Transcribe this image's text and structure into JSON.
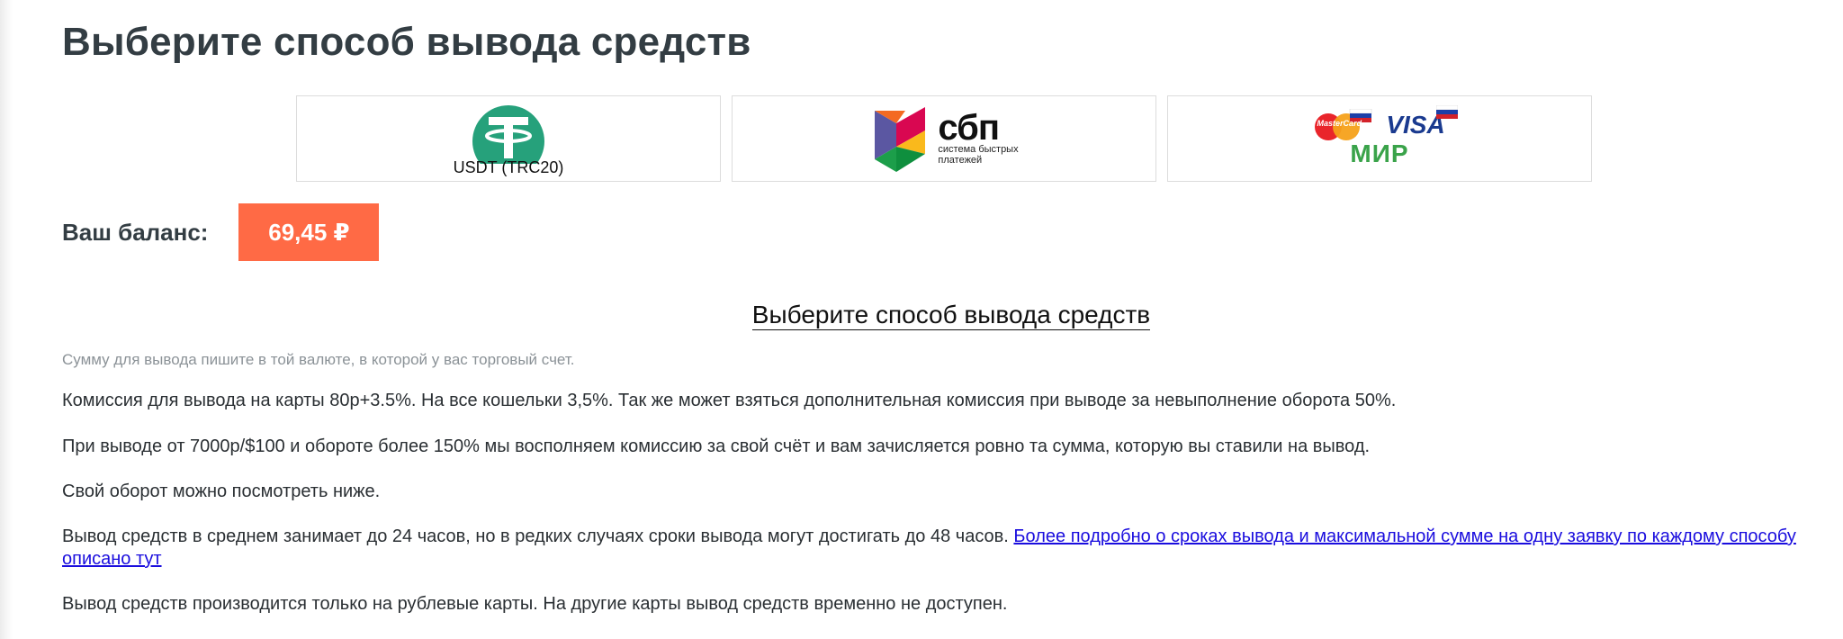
{
  "page": {
    "title": "Выберите способ вывода средств"
  },
  "methods": [
    {
      "label": "USDT (TRC20)",
      "icon": "tether-icon",
      "color": "#26a17b"
    },
    {
      "name": "сбп",
      "subtitle_line1": "система быстрых",
      "subtitle_line2": "платежей",
      "icon": "sbp-logo"
    },
    {
      "mastercard": "MasterCard",
      "visa": "VISA",
      "mir": "МИР",
      "icon": "cards-logo"
    }
  ],
  "balance": {
    "label": "Ваш баланс:",
    "value": "69,45 ₽",
    "color": "#ff6a45"
  },
  "section": {
    "heading": "Выберите способ вывода средств",
    "hint": "Сумму для вывода пишите в той валюте, в которой у вас торговый счет.",
    "p1": "Комиссия для вывода на карты 80р+3.5%. На все кошельки 3,5%. Так же может взяться дополнительная комиссия при выводе за невыполнение оборота 50%.",
    "p2": "При выводе от 7000р/$100 и обороте более 150% мы восполняем комиссию за свой счёт и вам зачисляется ровно та сумма, которую вы ставили на вывод.",
    "p3": "Свой оборот можно посмотреть ниже.",
    "p4": "Вывод средств в среднем занимает до 24 часов, но в редких случаях сроки вывода могут достигать до 48 часов.",
    "p4_link": "Более подробно о сроках вывода и максимальной сумме на одну заявку по каждому способу описано тут",
    "p5": "Вывод средств производится только на рублевые карты. На другие карты вывод средств временно не доступен."
  }
}
